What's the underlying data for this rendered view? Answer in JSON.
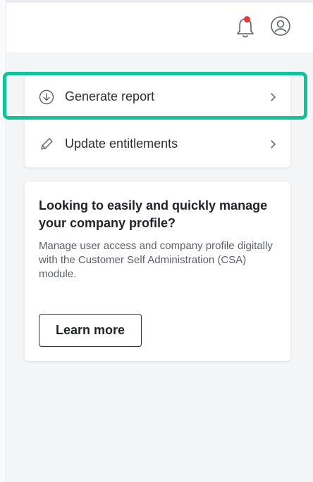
{
  "header": {
    "notification_icon": "bell-icon",
    "notification_dot_color": "#e53935",
    "profile_icon": "user-circle-icon"
  },
  "actions": {
    "items": [
      {
        "label": "Generate report",
        "icon": "download-circle-icon"
      },
      {
        "label": "Update entitlements",
        "icon": "pencil-icon"
      }
    ],
    "highlight_color": "#13c398"
  },
  "promo": {
    "title": "Looking to easily and quickly manage your company profile?",
    "description": "Manage user access and company profile digitally with the Customer Self Administration (CSA) module.",
    "button_label": "Learn more"
  }
}
